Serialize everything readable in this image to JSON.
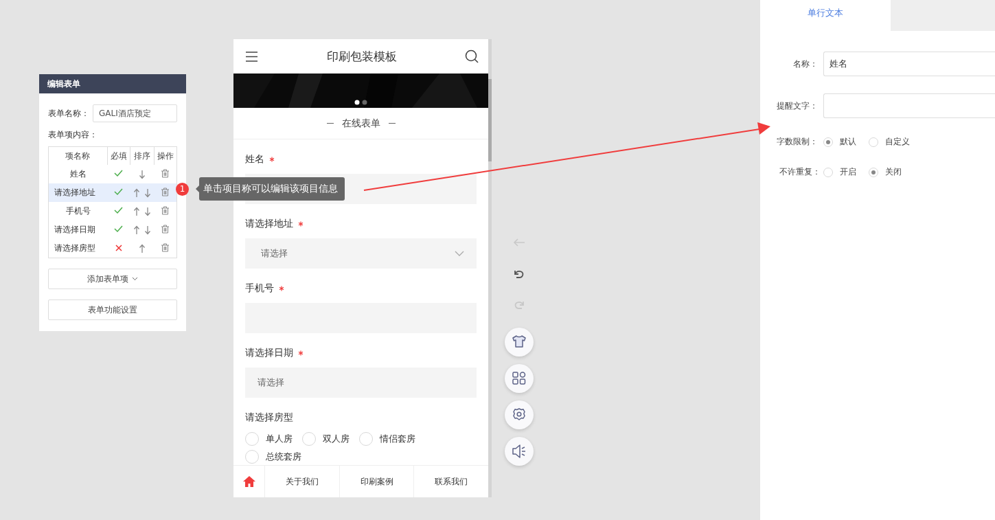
{
  "editor_panel": {
    "title": "编辑表单",
    "form_name_label": "表单名称：",
    "form_name_value": "GALI酒店预定",
    "items_label": "表单项内容：",
    "columns": [
      "项名称",
      "必填",
      "排序",
      "操作"
    ],
    "rows": [
      {
        "name": "姓名",
        "required": true,
        "can_move_up": false,
        "can_move_down": true,
        "selected": false
      },
      {
        "name": "请选择地址",
        "required": true,
        "can_move_up": true,
        "can_move_down": true,
        "selected": true
      },
      {
        "name": "手机号",
        "required": true,
        "can_move_up": true,
        "can_move_down": true,
        "selected": false
      },
      {
        "name": "请选择日期",
        "required": true,
        "can_move_up": true,
        "can_move_down": true,
        "selected": false
      },
      {
        "name": "请选择房型",
        "required": false,
        "can_move_up": true,
        "can_move_down": false,
        "selected": false
      }
    ],
    "buttons": [
      "添加表单项",
      "表单功能设置"
    ]
  },
  "tooltip": {
    "badge": "1",
    "text": "单击项目称可以编辑该项目信息"
  },
  "phone": {
    "title": "印刷包装模板",
    "banner_dots": [
      {
        "selected": true
      },
      {
        "selected": false
      }
    ],
    "section_title": "在线表单",
    "fields": [
      {
        "kind": "text",
        "label": "姓名",
        "required": true
      },
      {
        "kind": "select",
        "label": "请选择地址",
        "required": true,
        "placeholder": "请选择"
      },
      {
        "kind": "text",
        "label": "手机号",
        "required": true
      },
      {
        "kind": "date",
        "label": "请选择日期",
        "required": true,
        "placeholder": "请选择"
      },
      {
        "kind": "radio",
        "label": "请选择房型",
        "required": false,
        "options": [
          {
            "label": "单人房",
            "selected": false
          },
          {
            "label": "双人房",
            "selected": false
          },
          {
            "label": "情侣套房",
            "selected": false
          },
          {
            "label": "总统套房",
            "selected": false
          }
        ]
      }
    ],
    "nav": [
      {
        "kind": "home"
      },
      {
        "kind": "link",
        "label": "关于我们"
      },
      {
        "kind": "link",
        "label": "印刷案例"
      },
      {
        "kind": "link",
        "label": "联系我们"
      }
    ]
  },
  "tool_rail": [
    {
      "kind": "back",
      "disabled": true
    },
    {
      "kind": "undo",
      "disabled": false
    },
    {
      "kind": "redo",
      "disabled": true
    },
    {
      "kind": "shirt"
    },
    {
      "kind": "grid"
    },
    {
      "kind": "gear"
    },
    {
      "kind": "speaker"
    }
  ],
  "properties": {
    "tabs": [
      {
        "label": "单行文本",
        "selected": true
      }
    ],
    "name_label": "名称：",
    "name_value": "姓名",
    "hint_label": "提醒文字：",
    "limit_label": "字数限制：",
    "limit_options": [
      {
        "label": "默认",
        "selected": true
      },
      {
        "label": "自定义",
        "selected": false
      }
    ],
    "repeat_label": "不许重复：",
    "repeat_options": [
      {
        "label": "开启",
        "selected": false
      },
      {
        "label": "关闭",
        "selected": true
      }
    ]
  }
}
